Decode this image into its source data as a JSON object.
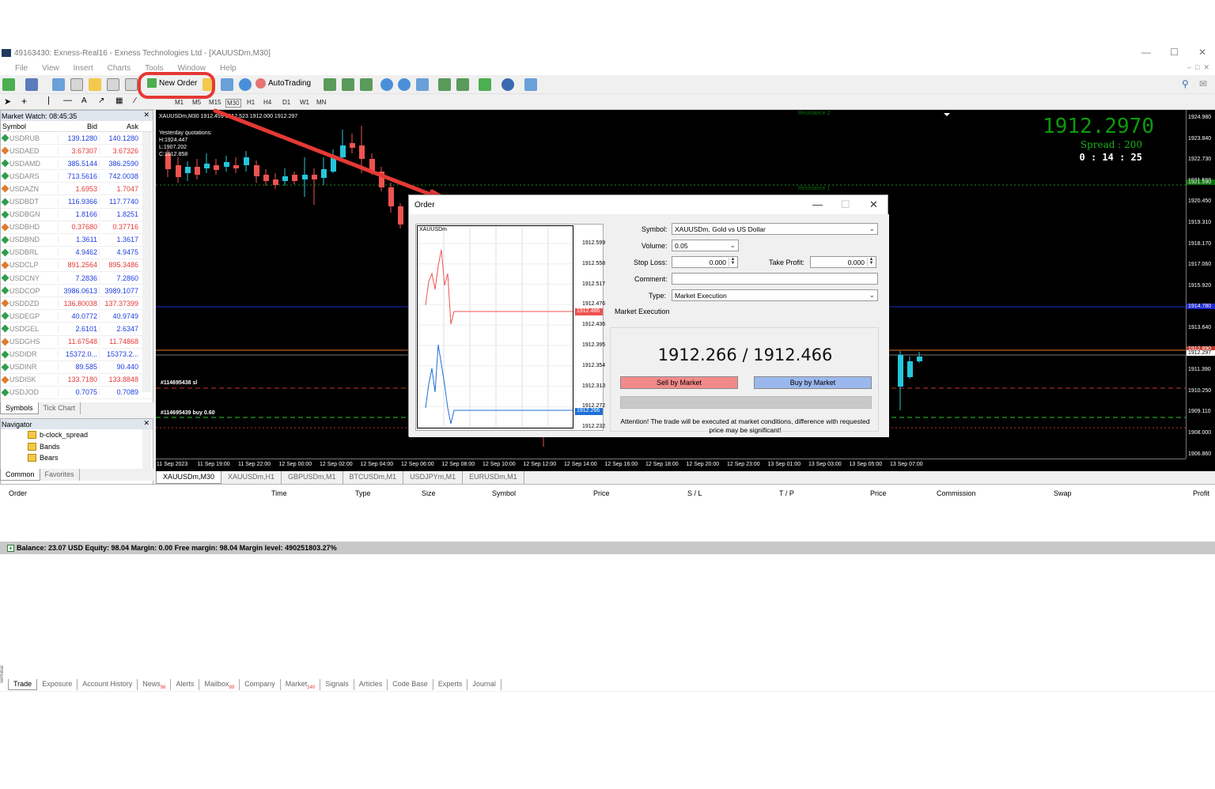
{
  "window": {
    "title": "49163430: Exness-Real16 - Exness Technologies Ltd - [XAUUSDm,M30]"
  },
  "menu": [
    "File",
    "View",
    "Insert",
    "Charts",
    "Tools",
    "Window",
    "Help"
  ],
  "toolbar": {
    "new_order_label": "New Order",
    "autotrading_label": "AutoTrading"
  },
  "timeframes": [
    "M1",
    "M5",
    "M15",
    "M30",
    "H1",
    "H4",
    "D1",
    "W1",
    "MN"
  ],
  "market_watch": {
    "title": "Market Watch: 08:45:35",
    "col_symbol": "Symbol",
    "col_bid": "Bid",
    "col_ask": "Ask",
    "rows": [
      {
        "symbol": "USDRUB",
        "bid": "139.1280",
        "ask": "140.1280"
      },
      {
        "symbol": "USDAED",
        "bid": "3.67307",
        "ask": "3.67326"
      },
      {
        "symbol": "USDAMD",
        "bid": "385.5144",
        "ask": "386.2590"
      },
      {
        "symbol": "USDARS",
        "bid": "713.5616",
        "ask": "742.0038"
      },
      {
        "symbol": "USDAZN",
        "bid": "1.6953",
        "ask": "1.7047"
      },
      {
        "symbol": "USDBDT",
        "bid": "116.9366",
        "ask": "117.7740"
      },
      {
        "symbol": "USDBGN",
        "bid": "1.8166",
        "ask": "1.8251"
      },
      {
        "symbol": "USDBHD",
        "bid": "0.37680",
        "ask": "0.37716"
      },
      {
        "symbol": "USDBND",
        "bid": "1.3611",
        "ask": "1.3617"
      },
      {
        "symbol": "USDBRL",
        "bid": "4.9462",
        "ask": "4.9475"
      },
      {
        "symbol": "USDCLP",
        "bid": "891.2564",
        "ask": "895.3486"
      },
      {
        "symbol": "USDCNY",
        "bid": "7.2836",
        "ask": "7.2860"
      },
      {
        "symbol": "USDCOP",
        "bid": "3986.0613",
        "ask": "3989.1077"
      },
      {
        "symbol": "USDDZD",
        "bid": "136.80038",
        "ask": "137.37399"
      },
      {
        "symbol": "USDEGP",
        "bid": "40.0772",
        "ask": "40.9749"
      },
      {
        "symbol": "USDGEL",
        "bid": "2.6101",
        "ask": "2.6347"
      },
      {
        "symbol": "USDGHS",
        "bid": "11.67548",
        "ask": "11.74868"
      },
      {
        "symbol": "USDIDR",
        "bid": "15372.0...",
        "ask": "15373.2..."
      },
      {
        "symbol": "USDINR",
        "bid": "89.585",
        "ask": "90.440"
      },
      {
        "symbol": "USDISK",
        "bid": "133.7180",
        "ask": "133.8848"
      },
      {
        "symbol": "USDJOD",
        "bid": "0.7075",
        "ask": "0.7089"
      }
    ],
    "tabs": [
      "Symbols",
      "Tick Chart"
    ]
  },
  "navigator": {
    "title": "Navigator",
    "items": [
      "b-clock_spread",
      "Bands",
      "Bears"
    ],
    "tabs": [
      "Common",
      "Favorites"
    ]
  },
  "chart": {
    "header": "XAUUSDm,M30  1912.459 1912.523 1912.000 1912.297",
    "yesterday_title": "Yesterday quotations:",
    "yesterday_high": "H:1924.447",
    "yesterday_low": "L:1907.202",
    "yesterday_close": "C:1912.858",
    "big_price": "1912.2970",
    "spread": "Spread : 200",
    "timer": "0 : 14 : 25",
    "resistance1": "Resistance 1",
    "resistance2": "Resistance 2",
    "order_sl": "#114695438 sl",
    "order_buy": "#114695439 buy 0.60",
    "y_ticks": [
      "1924.980",
      "1923.840",
      "1922.730",
      "1921.590",
      "1920.450",
      "1919.310",
      "1918.170",
      "1917.060",
      "1915.920",
      "1914.780",
      "1913.640",
      "1912.297",
      "1911.390",
      "1910.250",
      "1909.110",
      "1908.000",
      "1906.860"
    ],
    "price_tag_blue": "1914.780",
    "price_tag_green": "1921.590",
    "price_tag_red": "1912.890",
    "x_ticks": [
      "11 Sep 2023",
      "11 Sep 19:00",
      "11 Sep 22:00",
      "12 Sep 00:00",
      "12 Sep 02:00",
      "12 Sep 04:00",
      "12 Sep 06:00",
      "12 Sep 08:00",
      "12 Sep 10:00",
      "12 Sep 12:00",
      "12 Sep 14:00",
      "12 Sep 16:00",
      "12 Sep 18:00",
      "12 Sep 20:00",
      "12 Sep 23:00",
      "13 Sep 01:00",
      "13 Sep 03:00",
      "13 Sep 05:00",
      "13 Sep 07:00"
    ],
    "tabs": [
      "XAUUSDm,M30",
      "XAUUSDm,H1",
      "GBPUSDm,M1",
      "BTCUSDm,M1",
      "USDJPYm,M1",
      "EURUSDm,M1"
    ]
  },
  "terminal": {
    "columns": [
      "Order",
      "Time",
      "Type",
      "Size",
      "Symbol",
      "Price",
      "S / L",
      "T / P",
      "Price",
      "Commission",
      "Swap",
      "Profit"
    ],
    "balance_line": "Balance: 23.07 USD  Equity: 98.04  Margin: 0.00  Free margin: 98.04  Margin level: 490251803.27%",
    "tabs": [
      {
        "label": "Trade"
      },
      {
        "label": "Exposure"
      },
      {
        "label": "Account History"
      },
      {
        "label": "News",
        "badge": "96"
      },
      {
        "label": "Alerts"
      },
      {
        "label": "Mailbox",
        "badge": "89"
      },
      {
        "label": "Company"
      },
      {
        "label": "Market",
        "badge": "140"
      },
      {
        "label": "Signals"
      },
      {
        "label": "Articles"
      },
      {
        "label": "Code Base"
      },
      {
        "label": "Experts"
      },
      {
        "label": "Journal"
      }
    ],
    "side_label": "Terminal"
  },
  "order_dialog": {
    "title": "Order",
    "mini_chart_title": "XAUUSDm",
    "mini_ticks": [
      "1912.599",
      "1912.558",
      "1912.517",
      "1912.476",
      "1912.436",
      "1912.395",
      "1912.354",
      "1912.313",
      "1912.272",
      "1912.232"
    ],
    "mini_ask_tag": "1912.466",
    "mini_bid_tag": "1912.266",
    "symbol_label": "Symbol:",
    "symbol_value": "XAUUSDm, Gold vs US Dollar",
    "volume_label": "Volume:",
    "volume_value": "0.05",
    "stoploss_label": "Stop Loss:",
    "stoploss_value": "0.000",
    "takeprofit_label": "Take Profit:",
    "takeprofit_value": "0.000",
    "comment_label": "Comment:",
    "comment_value": "",
    "type_label": "Type:",
    "type_value": "Market Execution",
    "group_label": "Market Execution",
    "quote": "1912.266 / 1912.466",
    "sell_label": "Sell by Market",
    "buy_label": "Buy by Market",
    "attention": "Attention! The trade will be executed at market conditions, difference with requested price may be significant!"
  },
  "colors": {
    "accent_red": "#e53935",
    "bull": "#26c6da",
    "bear": "#ef5350",
    "sell": "#f28a8a",
    "buy": "#9bb8ee"
  }
}
